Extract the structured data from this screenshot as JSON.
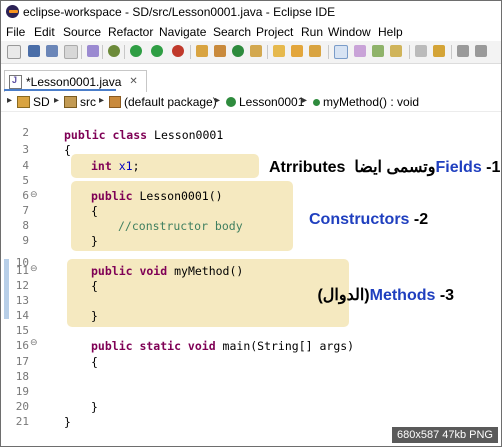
{
  "window": {
    "title": "eclipse-workspace - SD/src/Lesson0001.java - Eclipse IDE"
  },
  "menu": [
    "File",
    "Edit",
    "Source",
    "Refactor",
    "Navigate",
    "Search",
    "Project",
    "Run",
    "Window",
    "Help"
  ],
  "tab": {
    "label": "*Lesson0001.java"
  },
  "breadcrumb": [
    "SD",
    "src",
    "(default package)",
    "Lesson0001",
    "myMethod() : void"
  ],
  "code": {
    "line_numbers": [
      "2",
      "3",
      "4",
      "5",
      "6",
      "7",
      "8",
      "9",
      "10",
      "11",
      "12",
      "13",
      "14",
      "15",
      "16",
      "17",
      "18",
      "19",
      "20",
      "21"
    ],
    "class_decl": {
      "kw": "public class",
      "name": " Lesson0001"
    },
    "open_brace": "{",
    "field": {
      "kw": "int",
      "name": "x1",
      "end": ";"
    },
    "ctor_decl": {
      "kw": "public",
      "rest": " Lesson0001()"
    },
    "ctor_open": "{",
    "ctor_comment": "//constructor body",
    "ctor_close": "}",
    "method_decl": {
      "kw": "public void",
      "rest": " myMethod()"
    },
    "method_open": "{",
    "method_close": "}",
    "main_decl": {
      "kw": "public static void",
      "rest": " main(String[] args)"
    },
    "main_open": "{",
    "main_close": "}",
    "class_close": "}"
  },
  "annotations": {
    "fields": {
      "prefix": "Atrributes ",
      "arabic": "وتسمى ايضا ",
      "blue": "Fields",
      "suffix": " -1"
    },
    "constructors": {
      "blue": "Constructors",
      "suffix": " -2"
    },
    "methods": {
      "arabic": "(الدوال) ",
      "blue": "Methods",
      "suffix": " -3"
    }
  },
  "status_overlay": "680x587  47kb  PNG",
  "colors": {
    "keyword": "#7f0055",
    "field": "#0000c0",
    "comment": "#3f7f5f",
    "highlight": "#f5e9c0",
    "annotation_blue": "#1f3fbf"
  }
}
